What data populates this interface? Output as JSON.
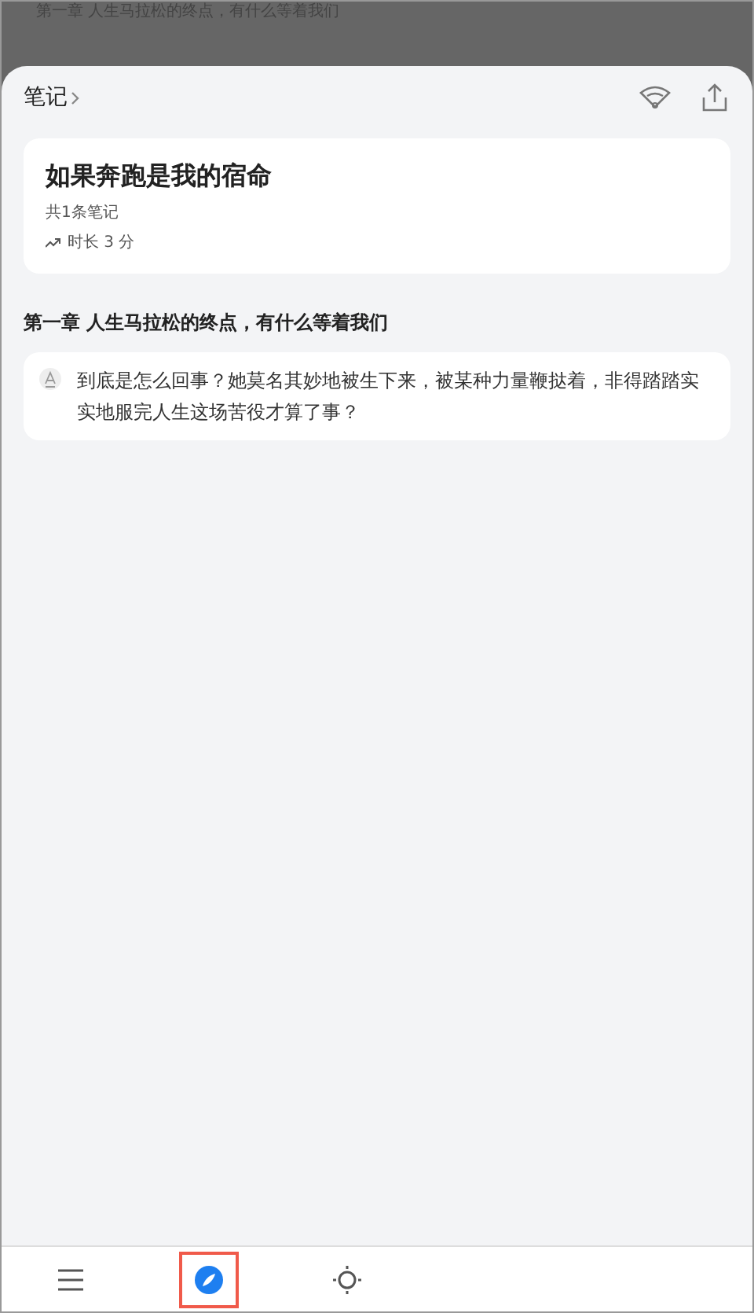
{
  "background": {
    "chapter_title": "第一章 人生马拉松的终点，有什么等着我们"
  },
  "sheet": {
    "title": "笔记",
    "book": {
      "title": "如果奔跑是我的宿命",
      "count": "共1条笔记",
      "duration": "时长 3 分"
    },
    "chapter": "第一章 人生马拉松的终点，有什么等着我们",
    "notes": [
      {
        "text": "到底是怎么回事？她莫名其妙地被生下来，被某种力量鞭挞着，非得踏踏实实地服完人生这场苦役才算了事？"
      }
    ]
  },
  "bottom_nav": [
    {
      "kind": "menu",
      "selected": false
    },
    {
      "kind": "compass",
      "selected": true
    },
    {
      "kind": "brightness",
      "selected": false
    }
  ]
}
